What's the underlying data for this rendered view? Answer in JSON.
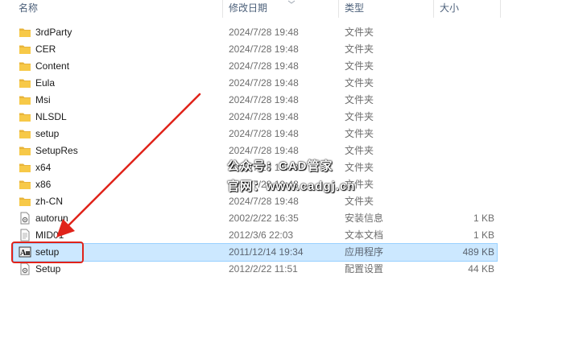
{
  "header": {
    "col_name": "名称",
    "col_date": "修改日期",
    "col_type": "类型",
    "col_size": "大小"
  },
  "files": [
    {
      "name": "3rdParty",
      "date": "2024/7/28 19:48",
      "type": "文件夹",
      "size": "",
      "icon": "folder-icon"
    },
    {
      "name": "CER",
      "date": "2024/7/28 19:48",
      "type": "文件夹",
      "size": "",
      "icon": "folder-icon"
    },
    {
      "name": "Content",
      "date": "2024/7/28 19:48",
      "type": "文件夹",
      "size": "",
      "icon": "folder-icon"
    },
    {
      "name": "Eula",
      "date": "2024/7/28 19:48",
      "type": "文件夹",
      "size": "",
      "icon": "folder-icon"
    },
    {
      "name": "Msi",
      "date": "2024/7/28 19:48",
      "type": "文件夹",
      "size": "",
      "icon": "folder-icon"
    },
    {
      "name": "NLSDL",
      "date": "2024/7/28 19:48",
      "type": "文件夹",
      "size": "",
      "icon": "folder-icon"
    },
    {
      "name": "setup",
      "date": "2024/7/28 19:48",
      "type": "文件夹",
      "size": "",
      "icon": "folder-icon"
    },
    {
      "name": "SetupRes",
      "date": "2024/7/28 19:48",
      "type": "文件夹",
      "size": "",
      "icon": "folder-icon"
    },
    {
      "name": "x64",
      "date": "2024/7/28 19:48",
      "type": "文件夹",
      "size": "",
      "icon": "folder-icon"
    },
    {
      "name": "x86",
      "date": "2024/7/28 19:48",
      "type": "文件夹",
      "size": "",
      "icon": "folder-icon"
    },
    {
      "name": "zh-CN",
      "date": "2024/7/28 19:48",
      "type": "文件夹",
      "size": "",
      "icon": "folder-icon"
    },
    {
      "name": "autorun",
      "date": "2002/2/22 16:35",
      "type": "安装信息",
      "size": "1 KB",
      "icon": "settings-file-icon"
    },
    {
      "name": "MID01",
      "date": "2012/3/6 22:03",
      "type": "文本文档",
      "size": "1 KB",
      "icon": "text-file-icon"
    },
    {
      "name": "setup",
      "date": "2011/12/14 19:34",
      "type": "应用程序",
      "size": "489 KB",
      "icon": "app-icon",
      "selected": true
    },
    {
      "name": "Setup",
      "date": "2012/2/22 11:51",
      "type": "配置设置",
      "size": "44 KB",
      "icon": "settings-file-icon"
    }
  ],
  "watermark": {
    "line1": "公众号：CAD管家",
    "line2": "官网：www.cadgj.cn"
  },
  "colors": {
    "selection_bg": "#cce8ff",
    "selection_border": "#99d1ff",
    "annotation_red": "#e0231a",
    "folder_yellow": "#f7c948"
  }
}
